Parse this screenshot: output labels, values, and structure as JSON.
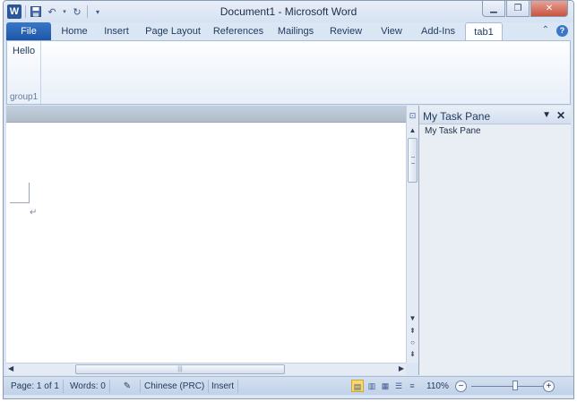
{
  "window": {
    "title": "Document1  -  Microsoft Word",
    "app_icon_letter": "W"
  },
  "qat": {
    "save_icon": "save-icon",
    "undo_icon": "undo-icon",
    "redo_icon": "redo-icon",
    "customize_icon": "customize-qat-icon"
  },
  "tabs": [
    {
      "label": "File"
    },
    {
      "label": "Home"
    },
    {
      "label": "Insert"
    },
    {
      "label": "Page Layout"
    },
    {
      "label": "References"
    },
    {
      "label": "Mailings"
    },
    {
      "label": "Review"
    },
    {
      "label": "View"
    },
    {
      "label": "Add-Ins"
    },
    {
      "label": "tab1"
    }
  ],
  "ribbon": {
    "button_label": "Hello",
    "group_label": "group1"
  },
  "task_pane": {
    "title": "My Task Pane",
    "body_text": "My Task Pane"
  },
  "status": {
    "page": "Page: 1 of 1",
    "words": "Words: 0",
    "language": "Chinese (PRC)",
    "mode": "Insert",
    "zoom": "110%"
  },
  "zoom_level_fraction": 0.6,
  "colors": {
    "file_tab": "#1d56a9",
    "ribbon_bg": "#fdfeff",
    "status_bg": "#c1d1e8"
  }
}
